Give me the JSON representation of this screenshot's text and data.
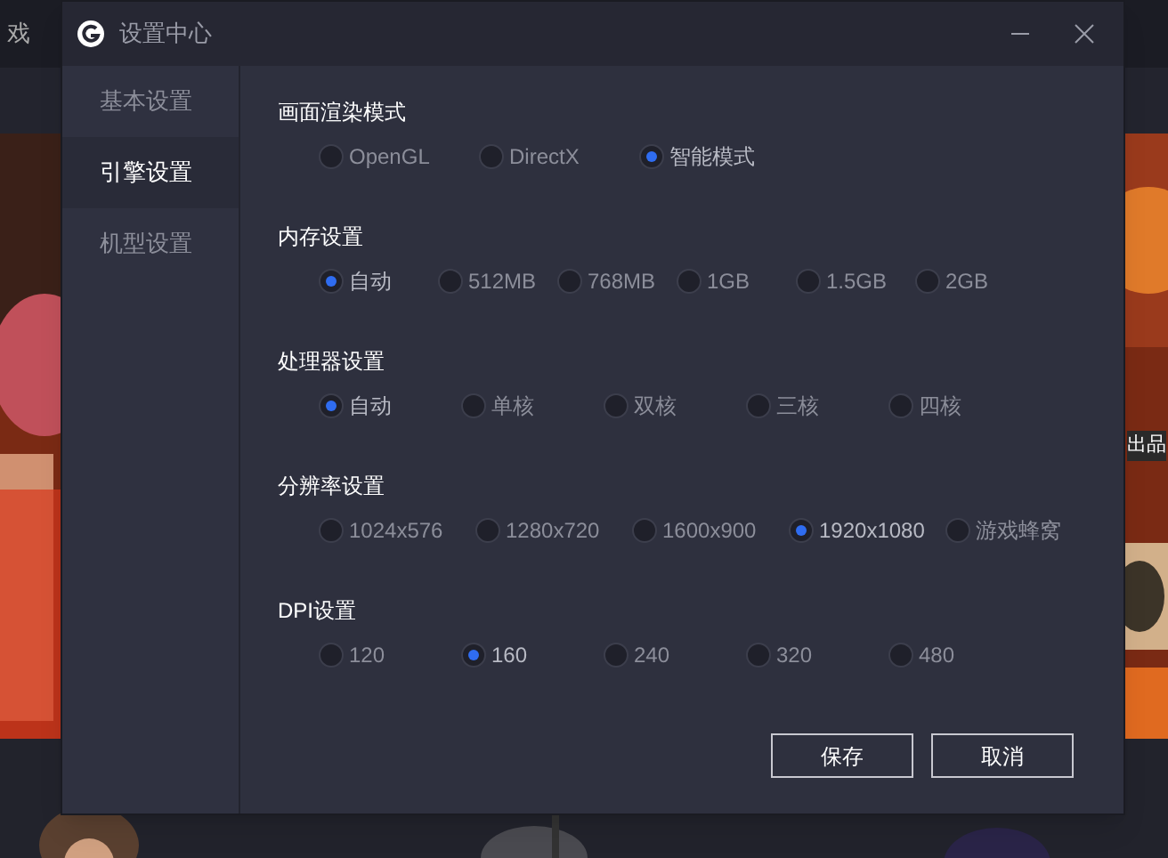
{
  "background": {
    "tab_label": "戏",
    "side_text": "出品"
  },
  "window": {
    "title": "设置中心"
  },
  "sidebar": {
    "items": [
      {
        "label": "基本设置",
        "selected": false
      },
      {
        "label": "引擎设置",
        "selected": true
      },
      {
        "label": "机型设置",
        "selected": false
      }
    ]
  },
  "groups": [
    {
      "title": "画面渲染模式",
      "options": [
        {
          "label": "OpenGL",
          "selected": false
        },
        {
          "label": "DirectX",
          "selected": false
        },
        {
          "label": "智能模式",
          "selected": true
        }
      ]
    },
    {
      "title": "内存设置",
      "options": [
        {
          "label": "自动",
          "selected": true
        },
        {
          "label": "512MB",
          "selected": false
        },
        {
          "label": "768MB",
          "selected": false
        },
        {
          "label": "1GB",
          "selected": false
        },
        {
          "label": "1.5GB",
          "selected": false
        },
        {
          "label": "2GB",
          "selected": false
        }
      ]
    },
    {
      "title": "处理器设置",
      "options": [
        {
          "label": "自动",
          "selected": true
        },
        {
          "label": "单核",
          "selected": false
        },
        {
          "label": "双核",
          "selected": false
        },
        {
          "label": "三核",
          "selected": false
        },
        {
          "label": "四核",
          "selected": false
        }
      ]
    },
    {
      "title": "分辨率设置",
      "options": [
        {
          "label": "1024x576",
          "selected": false
        },
        {
          "label": "1280x720",
          "selected": false
        },
        {
          "label": "1600x900",
          "selected": false
        },
        {
          "label": "1920x1080",
          "selected": true
        },
        {
          "label": "游戏蜂窝",
          "selected": false
        }
      ]
    },
    {
      "title": "DPI设置",
      "options": [
        {
          "label": "120",
          "selected": false
        },
        {
          "label": "160",
          "selected": true
        },
        {
          "label": "240",
          "selected": false
        },
        {
          "label": "320",
          "selected": false
        },
        {
          "label": "480",
          "selected": false
        }
      ]
    }
  ],
  "buttons": [
    "保存",
    "取消"
  ]
}
